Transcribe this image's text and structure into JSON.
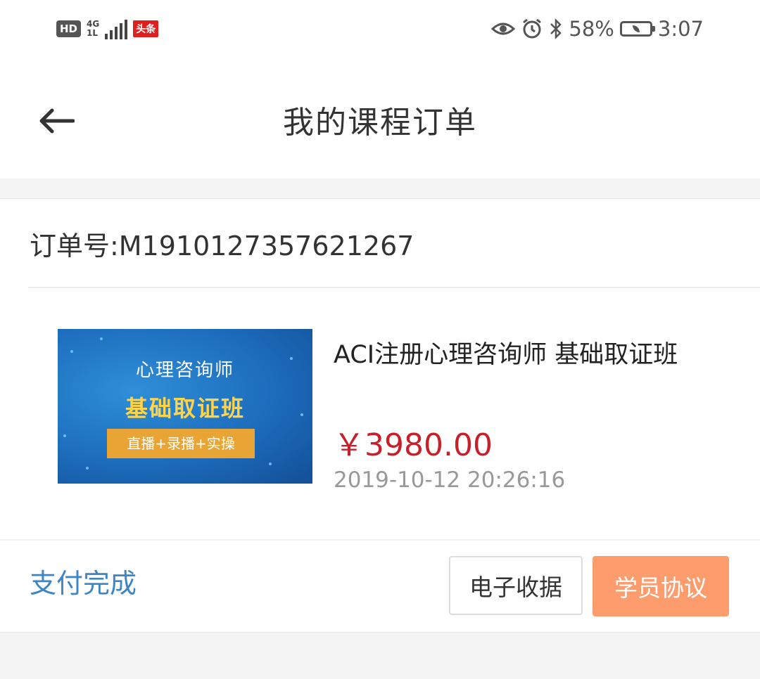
{
  "status_bar": {
    "hd": "HD",
    "network_type": "4G",
    "network_sub": "1L",
    "app_badge": "头条",
    "battery_percent": "58%",
    "time": "3:07",
    "battery_level": 0.58,
    "icons": [
      "eye-icon",
      "alarm-icon",
      "bluetooth-icon",
      "battery-icon"
    ]
  },
  "header": {
    "title": "我的课程订单",
    "back_icon": "arrow-left-icon"
  },
  "order": {
    "order_number_label": "订单号:M1910127357621267",
    "thumbnail": {
      "line1": "心理咨询师",
      "line2": "基础取证班",
      "tag": "直播+录播+实操"
    },
    "course_title": "ACI注册心理咨询师 基础取证班",
    "price": "￥3980.00",
    "order_time": "2019-10-12 20:26:16",
    "status": "支付完成",
    "buttons": {
      "receipt": "电子收据",
      "agreement": "学员协议"
    }
  },
  "colors": {
    "price": "#c8202a",
    "status": "#3d86c6",
    "agreement_button": "#fd9c6c"
  }
}
